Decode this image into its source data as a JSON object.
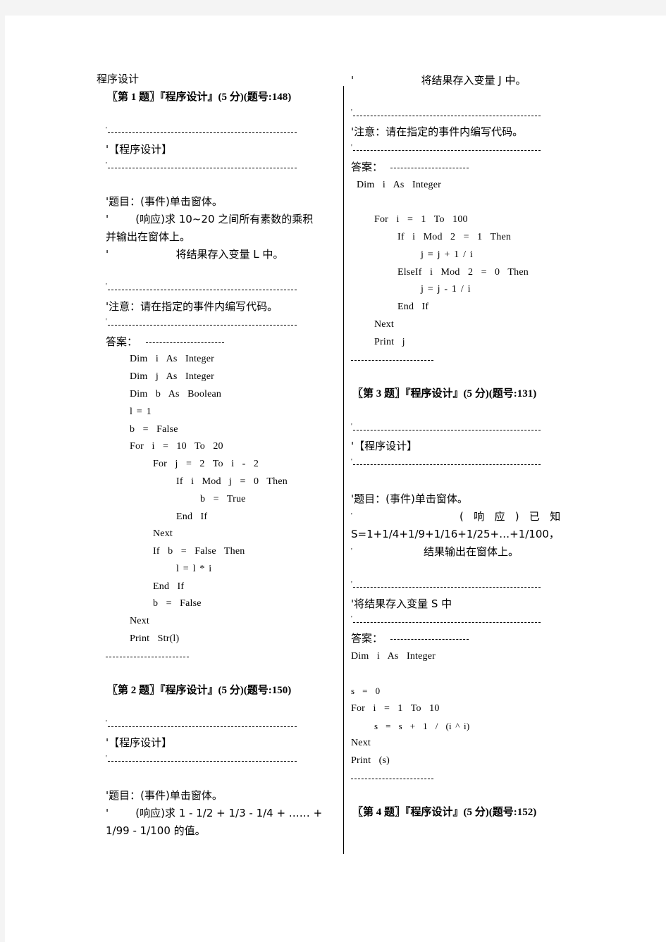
{
  "section_title": "程序设计",
  "questions": [
    {
      "heading": "〖第 1 题〗『程序设计』(5 分)(题号:148)",
      "tag": "'【程序设计】",
      "task": "'题目：(事件)单击窗体。",
      "response_line1": "'        (响应)求 10~20 之间所有素数的乘积",
      "response_line2": "并输出在窗体上。",
      "store_line": "'                    将结果存入变量 L 中。",
      "note": "'注意：请在指定的事件内编写代码。",
      "answer_label": "答案：",
      "code": [
        "Dim  i  As  Integer",
        "Dim  j  As  Integer",
        "Dim  b  As  Boolean",
        "l = 1",
        "b  =  False",
        "For  i  =  10  To  20",
        "For  j  =  2  To  i  -  2",
        "If  i  Mod  j  =  0  Then",
        "b  =  True",
        "End  If",
        "Next",
        "If  b  =  False  Then",
        "l = l * i",
        "End  If",
        "b  =  False",
        "Next",
        "Print  Str(l)"
      ]
    },
    {
      "heading": "〖第 2 题〗『程序设计』(5 分)(题号:150)",
      "tag": "'【程序设计】",
      "task": "'题目：(事件)单击窗体。",
      "response_line1": "'        (响应)求 1 - 1/2 + 1/3 - 1/4 + …… +",
      "response_line2": "1/99 - 1/100 的值。",
      "store_line": "'                    将结果存入变量 J 中。",
      "note": "'注意：请在指定的事件内编写代码。",
      "answer_label": "答案：",
      "code": [
        "Dim  i  As  Integer",
        "For  i  =  1  To  100",
        "If  i  Mod  2  =  1  Then",
        "j = j + 1 / i",
        "ElseIf  i  Mod  2  =  0  Then",
        "j = j - 1 / i",
        "End  If",
        "Next",
        "Print  j"
      ]
    },
    {
      "heading": "〖第 3 题〗『程序设计』(5 分)(题号:131)",
      "tag": "'【程序设计】",
      "task": "'题目：(事件)单击窗体。",
      "response_line1": "(   响   应   )   已   知",
      "response_line2": "S=1+1/4+1/9+1/16+1/25+…+1/100，",
      "store_line": "结果输出在窗体上。",
      "note": "'将结果存入变量 S 中",
      "answer_label": "答案：",
      "code": [
        "Dim  i  As  Integer",
        "s  =  0",
        "For  i  =  1  To  10",
        "s  =  s  +  1  /  (i ^ i)",
        "Next",
        "Print  (s)"
      ]
    },
    {
      "heading": "〖第 4 题〗『程序设计』(5 分)(题号:152)"
    }
  ]
}
